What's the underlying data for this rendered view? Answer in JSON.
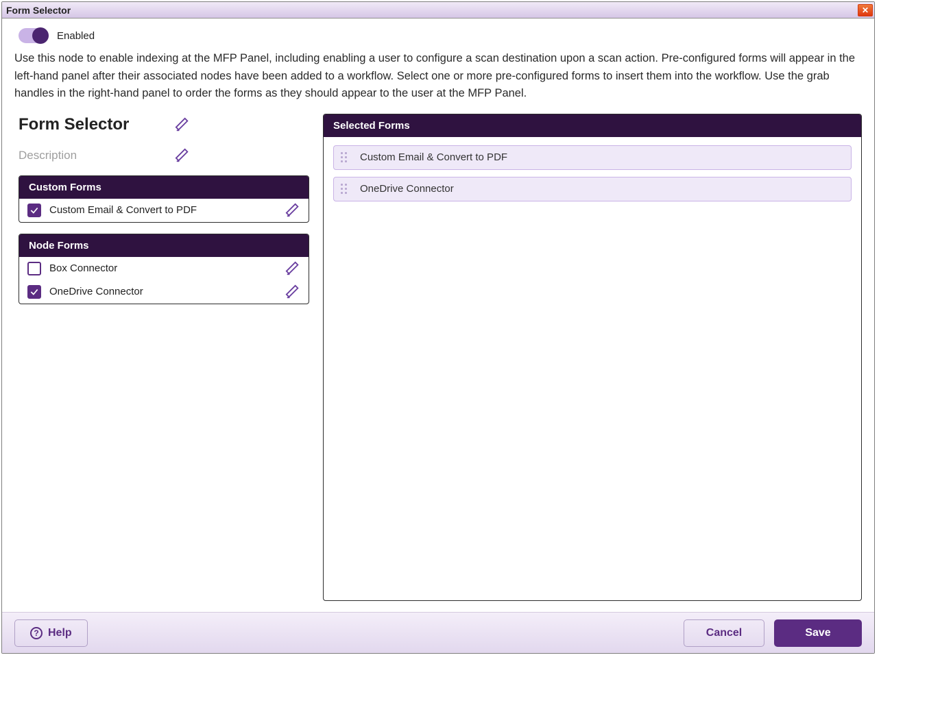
{
  "window": {
    "title": "Form Selector"
  },
  "toggle": {
    "enabled_label": "Enabled"
  },
  "description_text": "Use this node to enable indexing at the MFP Panel, including enabling a user to configure a scan destination upon a scan action. Pre-configured forms will appear in the left-hand panel after their associated nodes have been added to a workflow. Select one or more pre-configured forms to insert them into the workflow. Use the grab handles in the right-hand panel to order the forms as they should appear to the user at the MFP Panel.",
  "editor": {
    "name_value": "Form Selector",
    "description_placeholder": "Description"
  },
  "panels": {
    "custom_forms_header": "Custom Forms",
    "node_forms_header": "Node Forms",
    "selected_forms_header": "Selected Forms"
  },
  "custom_forms": [
    {
      "label": "Custom Email & Convert to PDF",
      "checked": true
    }
  ],
  "node_forms": [
    {
      "label": "Box Connector",
      "checked": false
    },
    {
      "label": "OneDrive Connector",
      "checked": true
    }
  ],
  "selected_forms": [
    {
      "label": "Custom Email & Convert to PDF"
    },
    {
      "label": "OneDrive Connector"
    }
  ],
  "footer": {
    "help_label": "Help",
    "cancel_label": "Cancel",
    "save_label": "Save"
  }
}
